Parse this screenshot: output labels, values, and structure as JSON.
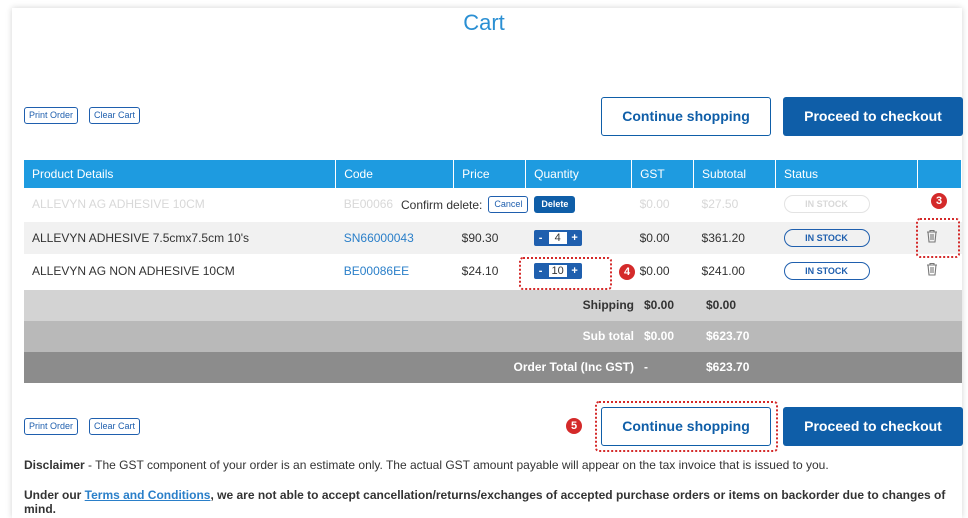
{
  "page": {
    "title": "Cart"
  },
  "top_actions": {
    "print_order": "Print Order",
    "clear_cart": "Clear Cart",
    "continue_shopping": "Continue shopping",
    "proceed_checkout": "Proceed to checkout"
  },
  "table": {
    "headers": [
      "Product Details",
      "Code",
      "Price",
      "Quantity",
      "GST",
      "Subtotal",
      "Status"
    ],
    "rows": [
      {
        "product": "ALLEVYN AG ADHESIVE 10CM",
        "code": "BE00066",
        "price": "",
        "qty": "",
        "gst": "$0.00",
        "subtotal": "$27.50",
        "status": "IN STOCK"
      },
      {
        "product": "ALLEVYN ADHESIVE 7.5cmx7.5cm 10's",
        "code": "SN66000043",
        "price": "$90.30",
        "qty": "4",
        "gst": "$0.00",
        "subtotal": "$361.20",
        "status": "IN STOCK"
      },
      {
        "product": "ALLEVYN AG NON ADHESIVE 10CM",
        "code": "BE00086EE",
        "price": "$24.10",
        "qty": "10",
        "gst": "$0.00",
        "subtotal": "$241.00",
        "status": "IN STOCK"
      }
    ],
    "qty_minus": "-",
    "qty_plus": "+"
  },
  "confirm_delete": {
    "label": "Confirm delete:",
    "cancel": "Cancel",
    "delete": "Delete"
  },
  "totals": {
    "shipping_label": "Shipping",
    "shipping_gst": "$0.00",
    "shipping_value": "$0.00",
    "subtotal_label": "Sub total",
    "subtotal_gst": "$0.00",
    "subtotal_value": "$623.70",
    "order_total_label": "Order Total (Inc GST)",
    "order_total_gst": "-",
    "order_total_value": "$623.70"
  },
  "bottom_actions": {
    "print_order": "Print Order",
    "clear_cart": "Clear Cart",
    "continue_shopping": "Continue shopping",
    "proceed_checkout": "Proceed to checkout"
  },
  "annotations": {
    "badge_3": "3",
    "badge_4": "4",
    "badge_5": "5"
  },
  "disclaimer": {
    "label": "Disclaimer",
    "text": " - The GST component of your order is an estimate only. The actual GST amount payable will appear on the tax invoice that is issued to you."
  },
  "terms": {
    "prefix": "Under our ",
    "link": "Terms and Conditions",
    "suffix": ", we are not able to accept cancellation/returns/exchanges of accepted purchase orders or items on backorder due to changes of mind."
  },
  "colors": {
    "header": "#1e9be0",
    "primary": "#0f5ea8",
    "annotation": "#d42a2a"
  }
}
